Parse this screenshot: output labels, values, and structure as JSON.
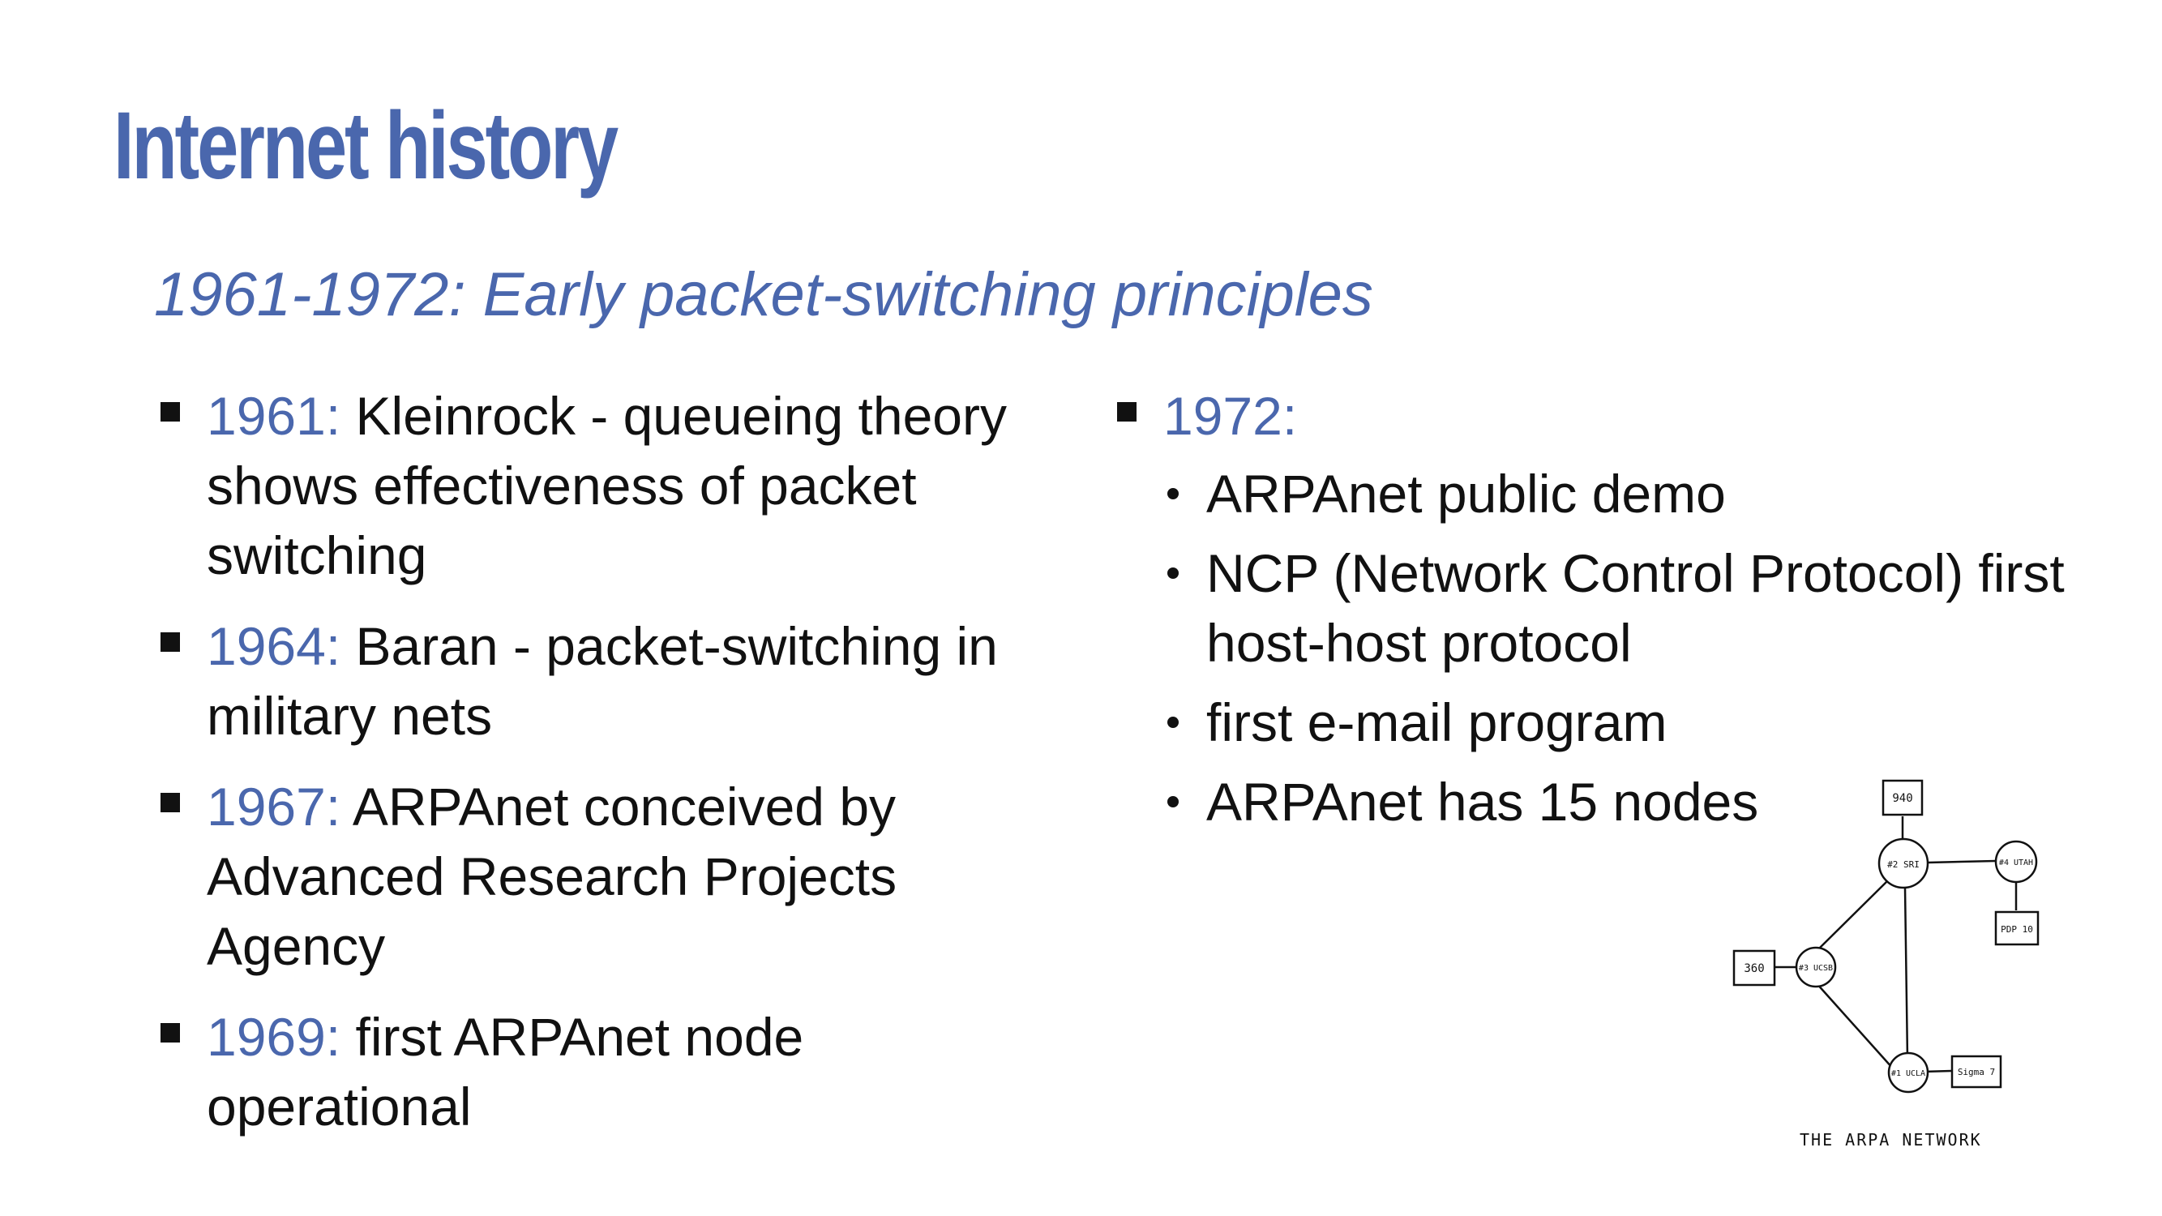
{
  "slide": {
    "title": "Internet history",
    "subtitle": "1961-1972: Early packet-switching principles"
  },
  "left_items": [
    {
      "year": "1961:",
      "text": " Kleinrock - queueing theory shows effectiveness of packet switching"
    },
    {
      "year": "1964:",
      "text": " Baran - packet-switching in military nets"
    },
    {
      "year": "1967:",
      "text": " ARPAnet conceived by Advanced Research Projects Agency"
    },
    {
      "year": "1969:",
      "text": " first ARPAnet node operational"
    }
  ],
  "right_item": {
    "year": "1972:",
    "subitems": [
      "ARPAnet public demo",
      "NCP (Network Control Protocol) first host-host protocol",
      "first e-mail program",
      "ARPAnet has 15 nodes"
    ]
  },
  "diagram": {
    "caption": "THE ARPA NETWORK",
    "nodes": {
      "sri": "#2 SRI",
      "utah": "#4 UTAH",
      "ucsb": "#3 UCSB",
      "ucla": "#1 UCLA"
    },
    "hosts": {
      "h940": "940",
      "pdp10": "PDP 10",
      "h360": "360",
      "sigma7": "Sigma 7"
    }
  },
  "colors": {
    "accent": "#4a67ad",
    "text": "#111111",
    "background": "#ffffff"
  }
}
